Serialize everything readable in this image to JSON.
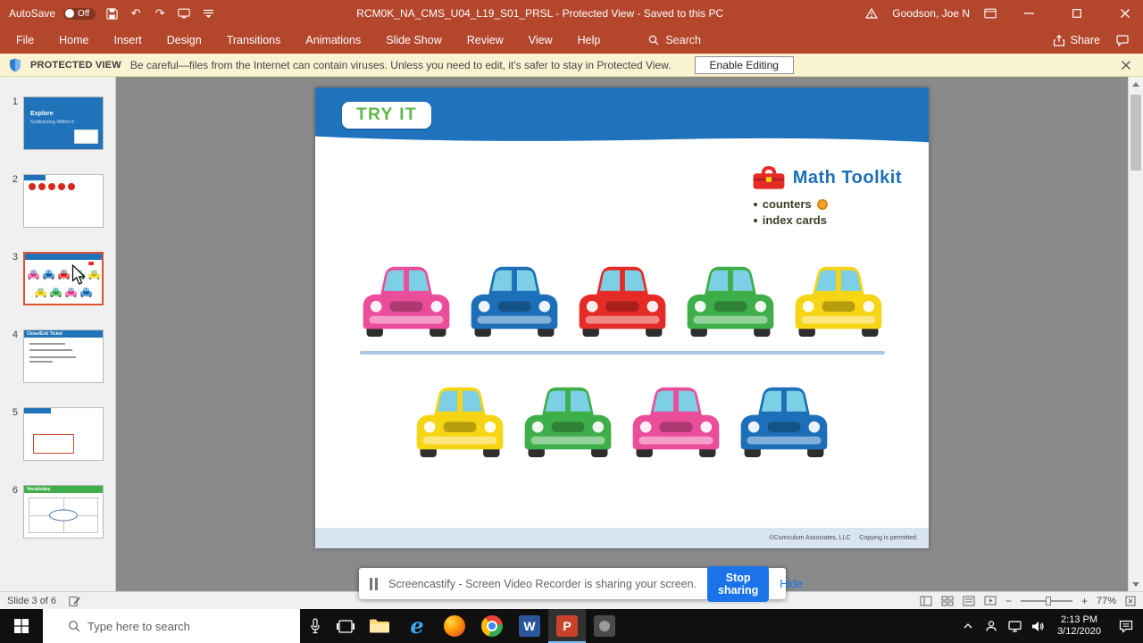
{
  "titlebar": {
    "autosave_label": "AutoSave",
    "autosave_state": "Off",
    "title": "RCM0K_NA_CMS_U04_L19_S01_PRSL  -  Protected View  -  Saved to this PC",
    "user": "Goodson, Joe N"
  },
  "ribbon": {
    "tabs": [
      "File",
      "Home",
      "Insert",
      "Design",
      "Transitions",
      "Animations",
      "Slide Show",
      "Review",
      "View",
      "Help"
    ],
    "search_label": "Search",
    "share_label": "Share"
  },
  "protected_banner": {
    "label": "PROTECTED VIEW",
    "message": "Be careful—files from the Internet can contain viruses. Unless you need to edit, it's safer to stay in Protected View.",
    "enable_button": "Enable Editing"
  },
  "thumbnails": [
    {
      "num": "1",
      "title": "Explore",
      "subtitle": "Subtracting Within 5"
    },
    {
      "num": "2"
    },
    {
      "num": "3"
    },
    {
      "num": "4",
      "title": "Close/Exit Ticket"
    },
    {
      "num": "5"
    },
    {
      "num": "6",
      "title": "Vocabulary"
    }
  ],
  "slide": {
    "tryit_label": "TRY IT",
    "tryit_color": "#5cb947",
    "header_color": "#1e73bc",
    "toolkit_title": "Math Toolkit",
    "toolkit_item1": "counters",
    "toolkit_item2": "index cards",
    "cars_top": [
      "#ea4e9b",
      "#1c6fb8",
      "#e42b26",
      "#3eae49",
      "#f6d515"
    ],
    "cars_bottom": [
      "#f6d515",
      "#3eae49",
      "#ea4e9b",
      "#1c6fb8"
    ],
    "footer": "©Curriculum Associates, LLC     Copying is permitted."
  },
  "screencastify": {
    "message": "Screencastify - Screen Video Recorder is sharing your screen.",
    "stop_button": "Stop sharing",
    "hide_link": "Hide"
  },
  "statusbar": {
    "slide_info": "Slide 3 of 6",
    "zoom_level": "77%"
  },
  "taskbar": {
    "search_placeholder": "Type here to search",
    "time": "2:13 PM",
    "date": "3/12/2020"
  }
}
